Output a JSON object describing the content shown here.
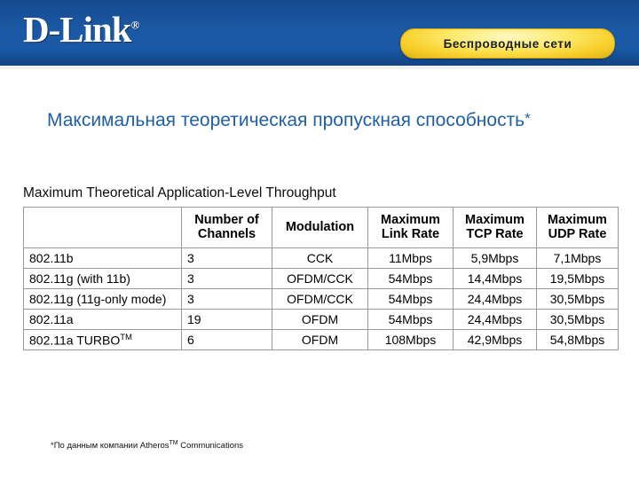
{
  "header": {
    "logo_text": "D-Link",
    "logo_registered": "®",
    "pill_label": "Беспроводные сети"
  },
  "slide": {
    "title": "Максимальная теоретическая пропускная способность",
    "title_star": "*",
    "english_caption": "Maximum Theoretical Application-Level Throughput",
    "footnote_prefix": "*По данным компании Atheros",
    "footnote_sup": "TM",
    "footnote_suffix": " Communications"
  },
  "table": {
    "columns": [
      {
        "line1": "",
        "line2": ""
      },
      {
        "line1": "Number of",
        "line2": "Channels"
      },
      {
        "line1": "Modulation",
        "line2": ""
      },
      {
        "line1": "Maximum",
        "line2": "Link Rate"
      },
      {
        "line1": "Maximum",
        "line2": "TCP Rate"
      },
      {
        "line1": "Maximum",
        "line2": "UDP Rate"
      }
    ],
    "rows": [
      {
        "standard": "802.11b",
        "standard_sup": "",
        "channels": "3",
        "modulation": "CCK",
        "link_rate": "11Mbps",
        "tcp_rate": "5,9Mbps",
        "udp_rate": "7,1Mbps"
      },
      {
        "standard": "802.11g (with 11b)",
        "standard_sup": "",
        "channels": "3",
        "modulation": "OFDM/CCK",
        "link_rate": "54Mbps",
        "tcp_rate": "14,4Mbps",
        "udp_rate": "19,5Mbps"
      },
      {
        "standard": "802.11g (11g-only mode)",
        "standard_sup": "",
        "channels": "3",
        "modulation": "OFDM/CCK",
        "link_rate": "54Mbps",
        "tcp_rate": "24,4Mbps",
        "udp_rate": "30,5Mbps"
      },
      {
        "standard": "802.11a",
        "standard_sup": "",
        "channels": "19",
        "modulation": "OFDM",
        "link_rate": "54Mbps",
        "tcp_rate": "24,4Mbps",
        "udp_rate": "30,5Mbps"
      },
      {
        "standard": "802.11a TURBO",
        "standard_sup": "TM",
        "channels": "6",
        "modulation": "OFDM",
        "link_rate": "108Mbps",
        "tcp_rate": "42,9Mbps",
        "udp_rate": "54,8Mbps"
      }
    ]
  },
  "colors": {
    "header_blue": "#1b59a6",
    "title_blue": "#1f5fa8",
    "pill_yellow": "#ffe96b",
    "table_border": "#9a9a9a"
  }
}
